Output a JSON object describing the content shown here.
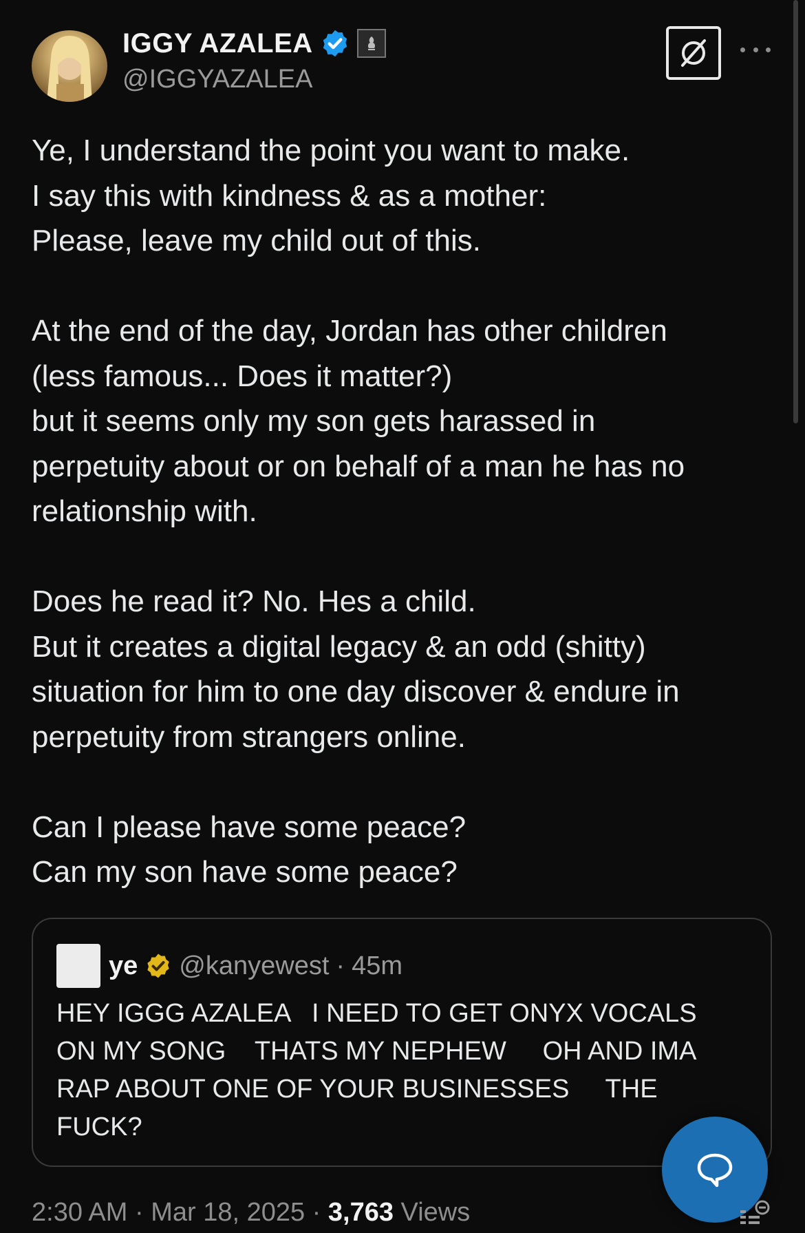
{
  "author": {
    "display_name": "IGGY AZALEA",
    "handle": "@IGGYAZALEA",
    "verified_icon": "verified-badge-blue",
    "affiliate_icon": "affiliate-badge"
  },
  "header_actions": {
    "grok_icon": "grok-icon",
    "more_icon": "more-icon"
  },
  "tweet": {
    "paragraphs": [
      "Ye, I understand the point you want to make.\nI say this with kindness & as a mother:\nPlease, leave my child out of this.",
      "At the end of the day, Jordan has other children\n(less famous... Does it matter?)\nbut it seems only my son gets harassed in\nperpetuity about or on behalf of a man he has no\nrelationship with.",
      "Does he read it? No. Hes a child.\nBut it creates a digital legacy & an odd (shitty)\nsituation for him to one day discover & endure in\nperpetuity from strangers online.",
      "Can I please have some peace?\nCan my son have some peace?"
    ]
  },
  "quote": {
    "name": "ye",
    "handle": "@kanyewest",
    "separator": "·",
    "time": "45m",
    "verified_icon": "verified-badge-gold",
    "text": "HEY IGGG AZALEA   I NEED TO GET ONYX VOCALS\nON MY SONG    THATS MY NEPHEW     OH AND IMA\nRAP ABOUT ONE OF YOUR BUSINESSES     THE\nFUCK?"
  },
  "meta": {
    "time": "2:30 AM",
    "sep1": " · ",
    "date": "Mar 18, 2025",
    "sep2": " · ",
    "views_count": "3,763",
    "views_label": " Views"
  },
  "fab": {
    "icon": "reply-bubble-icon"
  },
  "colors": {
    "background": "#0c0c0c",
    "text": "#e7e9ea",
    "muted": "#8e8e8e",
    "verified_blue": "#1d9bf0",
    "verified_gold": "#e2b719",
    "fab_blue": "#1b6fb2"
  }
}
